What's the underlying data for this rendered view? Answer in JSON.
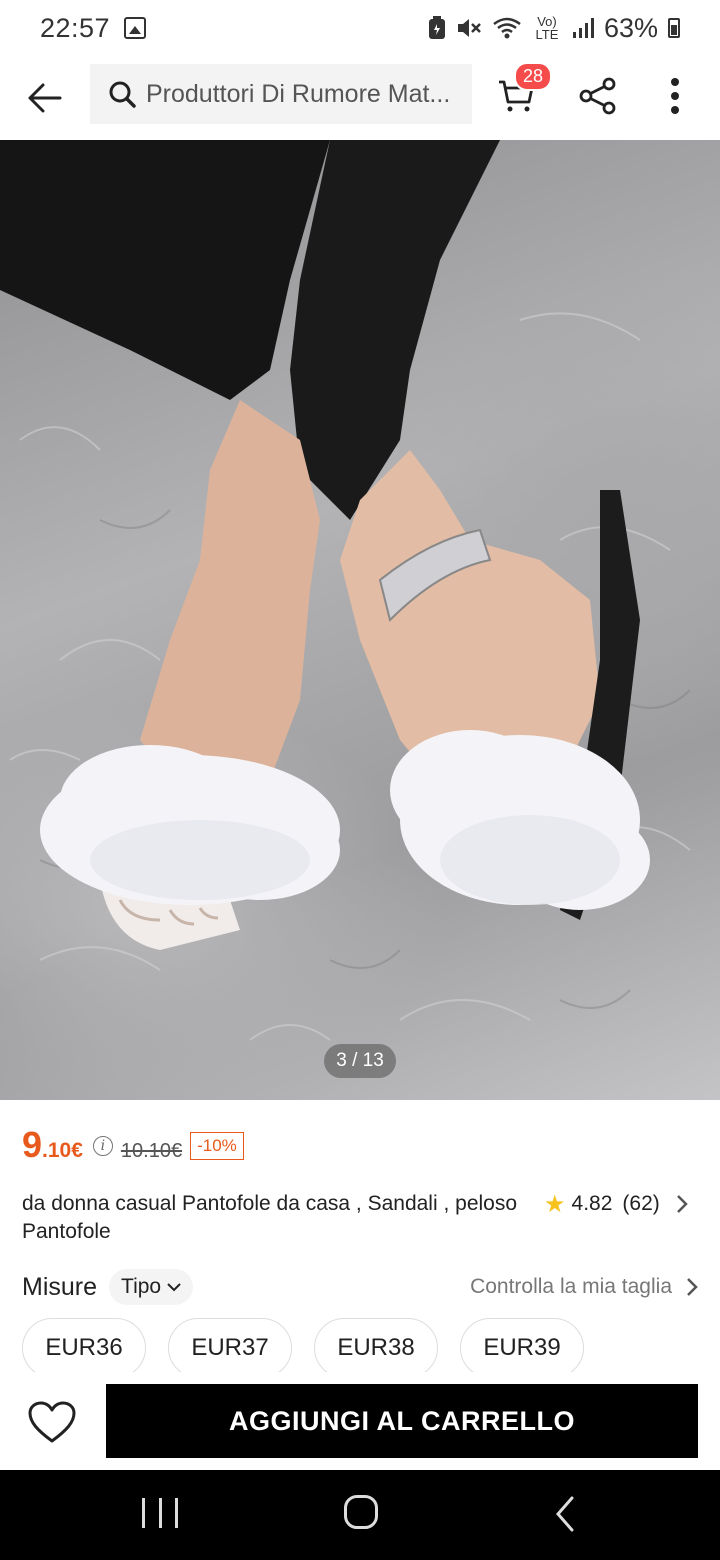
{
  "status_bar": {
    "time": "22:57",
    "network": "Vo) LTE",
    "battery": "63%"
  },
  "header": {
    "search_text": "Produttori Di Rumore Mat...",
    "cart_count": "28"
  },
  "gallery": {
    "counter": "3 / 13"
  },
  "price": {
    "main": "9",
    "cents": ".10€",
    "original": "10.10€",
    "discount": "-10%"
  },
  "product": {
    "title": "da donna casual Pantofole da casa , Sandali , peloso Pantofole",
    "rating": "4.82",
    "reviews": "(62)"
  },
  "size": {
    "label": "Misure",
    "type_label": "Tipo",
    "guide_label": "Controlla la mia taglia",
    "options": [
      "EUR36",
      "EUR37",
      "EUR38",
      "EUR39"
    ]
  },
  "actions": {
    "add_to_cart": "AGGIUNGI AL CARRELLO"
  },
  "icons": {
    "back": "arrow-left-icon",
    "search": "search-icon",
    "cart": "cart-icon",
    "share": "share-icon",
    "more": "more-vertical-icon",
    "wishlist": "heart-icon",
    "star": "star-icon"
  },
  "colors": {
    "price": "#e85a1c",
    "badge": "#f54b4b",
    "star": "#f8c21c",
    "cta": "#000000"
  }
}
